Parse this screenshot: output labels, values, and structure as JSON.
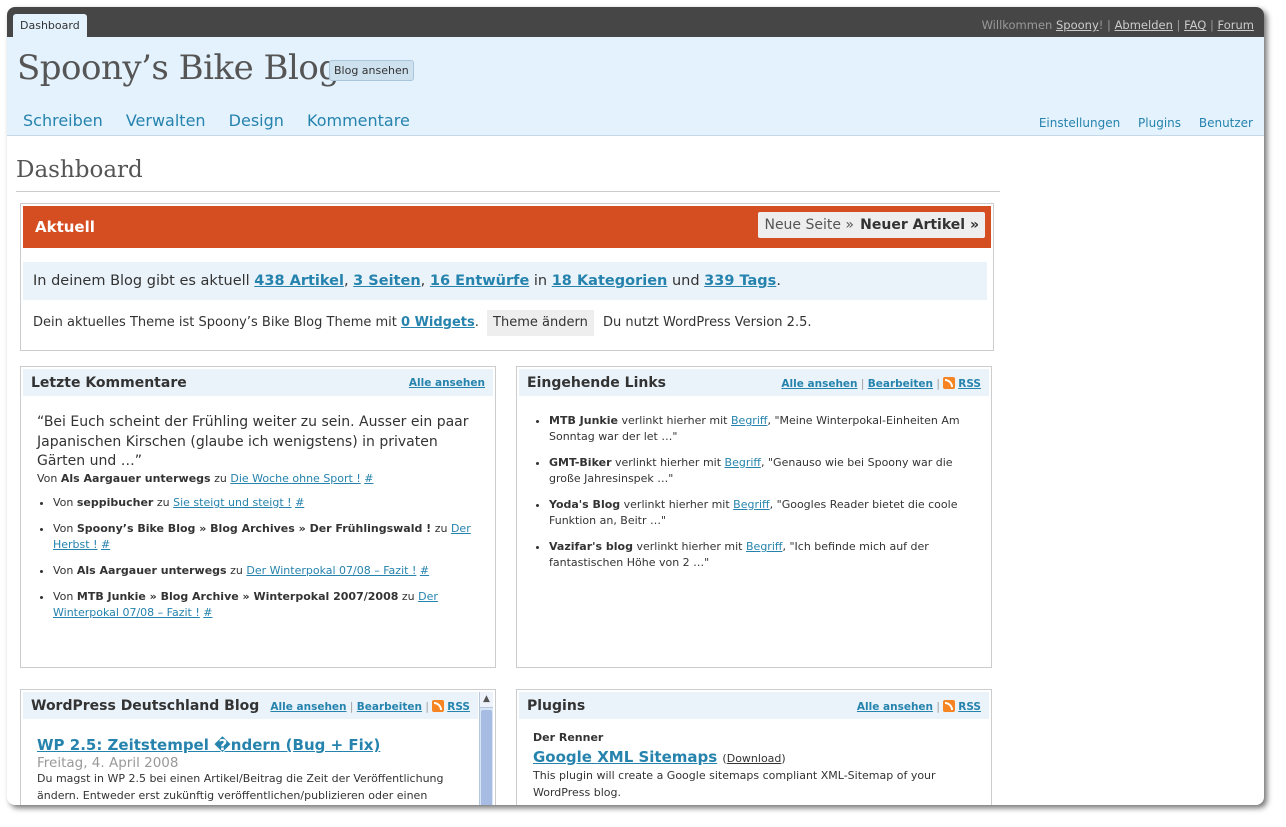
{
  "topbar": {
    "tab_label": "Dashboard",
    "welcome": "Willkommen",
    "username": "Spoony",
    "excl": "!",
    "sep": "|",
    "logout": "Abmelden",
    "faq": "FAQ",
    "forum": "Forum"
  },
  "header": {
    "blog_title": "Spoony’s Bike Blog",
    "view_blog": "Blog ansehen",
    "nav": [
      "Schreiben",
      "Verwalten",
      "Design",
      "Kommentare"
    ],
    "subnav": [
      "Einstellungen",
      "Plugins",
      "Benutzer"
    ]
  },
  "page_title": "Dashboard",
  "aktuell": {
    "title": "Aktuell",
    "new_page": "Neue Seite »",
    "new_post": "Neuer Artikel »",
    "stats_prefix": "In deinem Blog gibt es aktuell",
    "posts": "438 Artikel",
    "comma": ",",
    "pages": "3 Seiten",
    "drafts": "16 Entwürfe",
    "in": "in",
    "categories": "18 Kategorien",
    "und": "und",
    "tags": "339 Tags",
    "dot": ".",
    "theme_text": "Dein aktuelles Theme ist Spoony’s Bike Blog Theme mit",
    "widgets": "0 Widgets",
    "change_theme": "Theme ändern",
    "version_text": "Du nutzt WordPress Version 2.5."
  },
  "comments_widget": {
    "title": "Letzte Kommentare",
    "view_all": "Alle ansehen",
    "quote": "“Bei Euch scheint der Frühling weiter zu sein. Ausser ein paar Japanischen Kirschen (glaube ich wenigstens) in privaten Gärten und …”",
    "quote_von": "Von",
    "quote_author": "Als Aargauer unterwegs",
    "quote_zu": "zu",
    "quote_post": "Die Woche ohne Sport !",
    "hash": "#",
    "items": [
      {
        "von": "Von",
        "author": "seppibucher",
        "zu": "zu",
        "post": "Sie steigt und steigt !",
        "hash": "#"
      },
      {
        "von": "Von",
        "author": "Spoony’s Bike Blog » Blog Archives » Der Frühlingswald !",
        "zu": "zu",
        "post": "Der Herbst !",
        "hash": "#"
      },
      {
        "von": "Von",
        "author": "Als Aargauer unterwegs",
        "zu": "zu",
        "post": "Der Winterpokal 07/08 – Fazit !",
        "hash": "#"
      },
      {
        "von": "Von",
        "author": "MTB Junkie » Blog Archive » Winterpokal 2007/2008",
        "zu": "zu",
        "post": "Der Winterpokal 07/08 – Fazit !",
        "hash": "#"
      }
    ]
  },
  "links_widget": {
    "title": "Eingehende Links",
    "view_all": "Alle ansehen",
    "edit": "Bearbeiten",
    "rss": "RSS",
    "sep": "|",
    "items": [
      {
        "source": "MTB Junkie",
        "mid": "verlinkt hierher mit",
        "link": "Begriff",
        "text": ", \"Meine Winterpokal-Einheiten Am Sonntag war der let …\""
      },
      {
        "source": "GMT-Biker",
        "mid": "verlinkt hierher mit",
        "link": "Begriff",
        "text": ", \"Genauso wie bei Spoony war die große Jahresinspek …\""
      },
      {
        "source": "Yoda's Blog",
        "mid": "verlinkt hierher mit",
        "link": "Begriff",
        "text": ", \"Googles Reader bietet die coole Funktion an, Beitr …\""
      },
      {
        "source": "Vazifar's blog",
        "mid": "verlinkt hierher mit",
        "link": "Begriff",
        "text": ", \"Ich befinde mich auf der fantastischen Höhe von 2 …\""
      }
    ]
  },
  "wpde_widget": {
    "title": "WordPress Deutschland Blog",
    "view_all": "Alle ansehen",
    "edit": "Bearbeiten",
    "rss": "RSS",
    "sep": "|",
    "post_title": "WP 2.5: Zeitstempel �ndern (Bug + Fix)",
    "post_date": "Freitag, 4. April 2008",
    "post_excerpt": "Du magst in WP 2.5 bei einen Artikel/Beitrag die Zeit der Veröffentlichung ändern. Entweder erst zukünftig veröffentlichen/publizieren oder einen älteren"
  },
  "plugins_widget": {
    "title": "Plugins",
    "view_all": "Alle ansehen",
    "rss": "RSS",
    "sep": "|",
    "label": "Der Renner",
    "plugin_name": "Google XML Sitemaps",
    "paren_open": "(",
    "download": "Download",
    "paren_close": ")",
    "description": "This plugin will create a Google sitemaps compliant XML-Sitemap of your WordPress blog."
  },
  "colors": {
    "accent_orange": "#d54e21",
    "link_blue": "#2583ad",
    "header_bg": "#e4f2fd",
    "topbar_bg": "#464646"
  }
}
